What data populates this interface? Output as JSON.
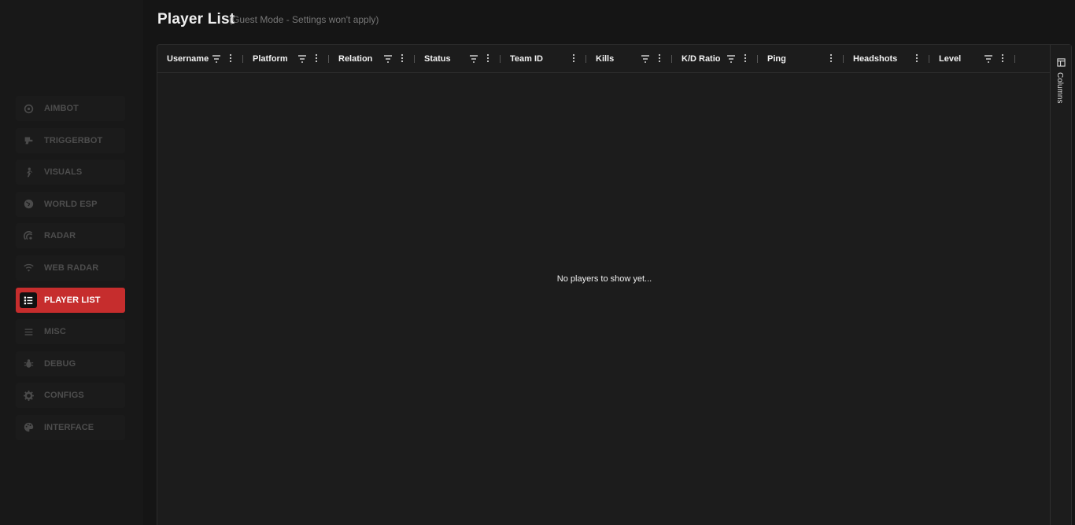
{
  "sidebar": {
    "items": [
      {
        "label": "AIMBOT",
        "icon": "crosshair-icon",
        "active": false
      },
      {
        "label": "TRIGGERBOT",
        "icon": "trigger-icon",
        "active": false
      },
      {
        "label": "VISUALS",
        "icon": "running-person-icon",
        "active": false
      },
      {
        "label": "WORLD ESP",
        "icon": "globe-icon",
        "active": false
      },
      {
        "label": "RADAR",
        "icon": "radar-icon",
        "active": false
      },
      {
        "label": "WEB RADAR",
        "icon": "wifi-icon",
        "active": false
      },
      {
        "label": "PLAYER LIST",
        "icon": "list-icon",
        "active": true
      },
      {
        "label": "MISC",
        "icon": "menu-icon",
        "active": false
      },
      {
        "label": "DEBUG",
        "icon": "bug-icon",
        "active": false
      },
      {
        "label": "CONFIGS",
        "icon": "gear-icon",
        "active": false
      },
      {
        "label": "INTERFACE",
        "icon": "palette-icon",
        "active": false
      }
    ]
  },
  "header": {
    "title": "Player List",
    "subtitle": "(Guest Mode - Settings won't apply)"
  },
  "grid": {
    "columns": [
      {
        "label": "Username",
        "filter": true
      },
      {
        "label": "Platform",
        "filter": true
      },
      {
        "label": "Relation",
        "filter": true
      },
      {
        "label": "Status",
        "filter": true
      },
      {
        "label": "Team ID",
        "filter": false
      },
      {
        "label": "Kills",
        "filter": true
      },
      {
        "label": "K/D Ratio",
        "filter": true
      },
      {
        "label": "Ping",
        "filter": false
      },
      {
        "label": "Headshots",
        "filter": false
      },
      {
        "label": "Level",
        "filter": true
      }
    ],
    "empty_message": "No players to show yet...",
    "side_panel_label": "Columns"
  },
  "colors": {
    "accent": "#c62d2d",
    "background": "#151515",
    "panel": "#1c1c1c"
  }
}
